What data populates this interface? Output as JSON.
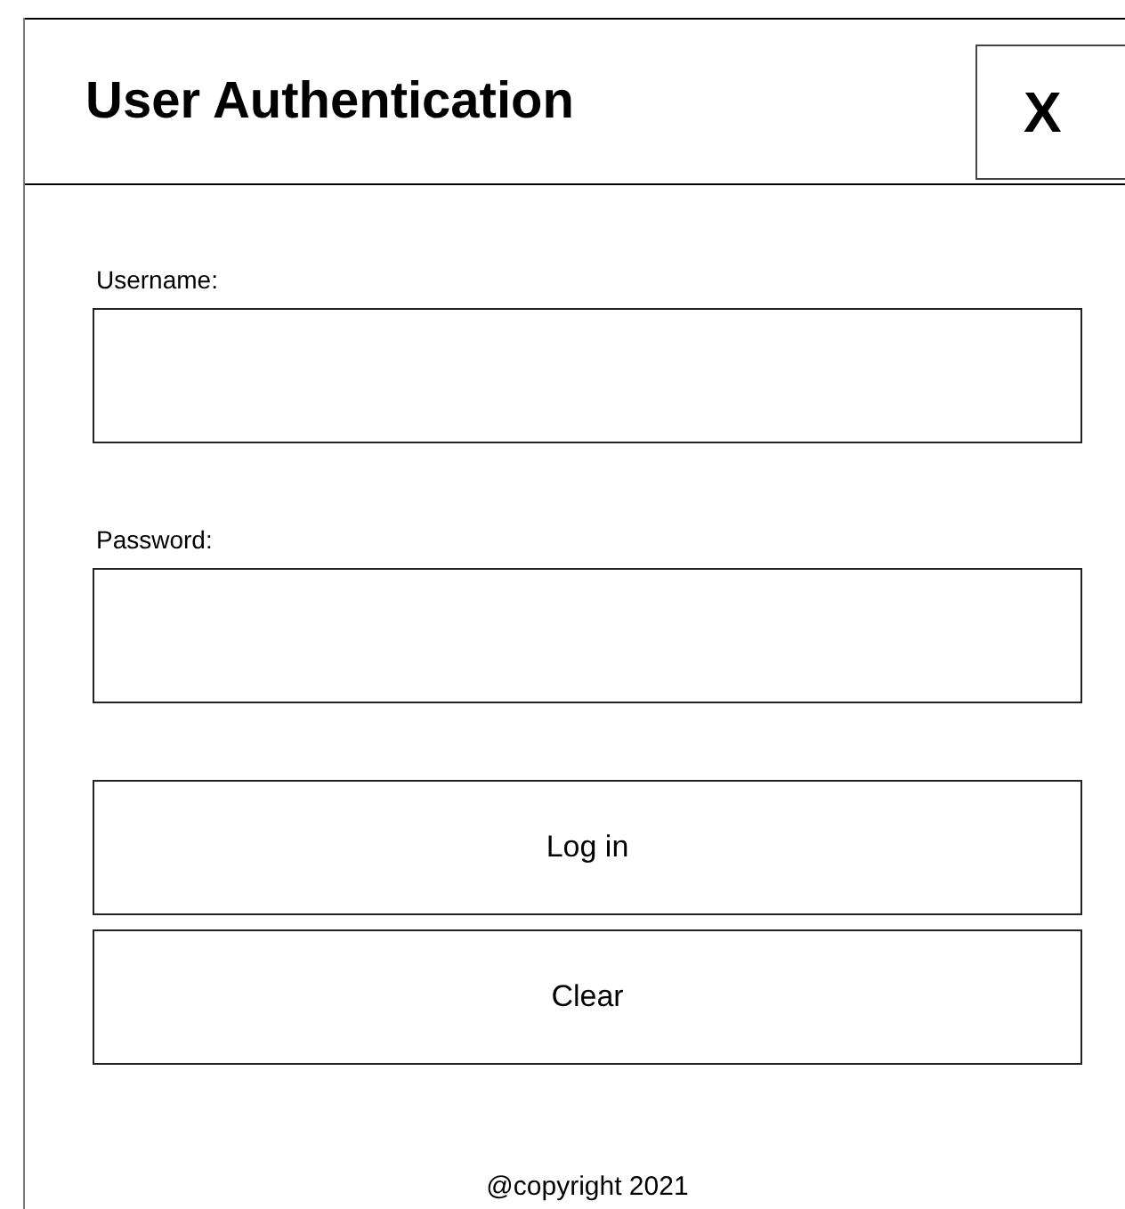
{
  "window": {
    "title": "User Authentication",
    "close_button": "X"
  },
  "fields": [
    {
      "label": "Username:"
    },
    {
      "label": "Password:"
    }
  ],
  "buttons": [
    "Log in",
    "Clear"
  ],
  "footer": "@copyright 2021"
}
